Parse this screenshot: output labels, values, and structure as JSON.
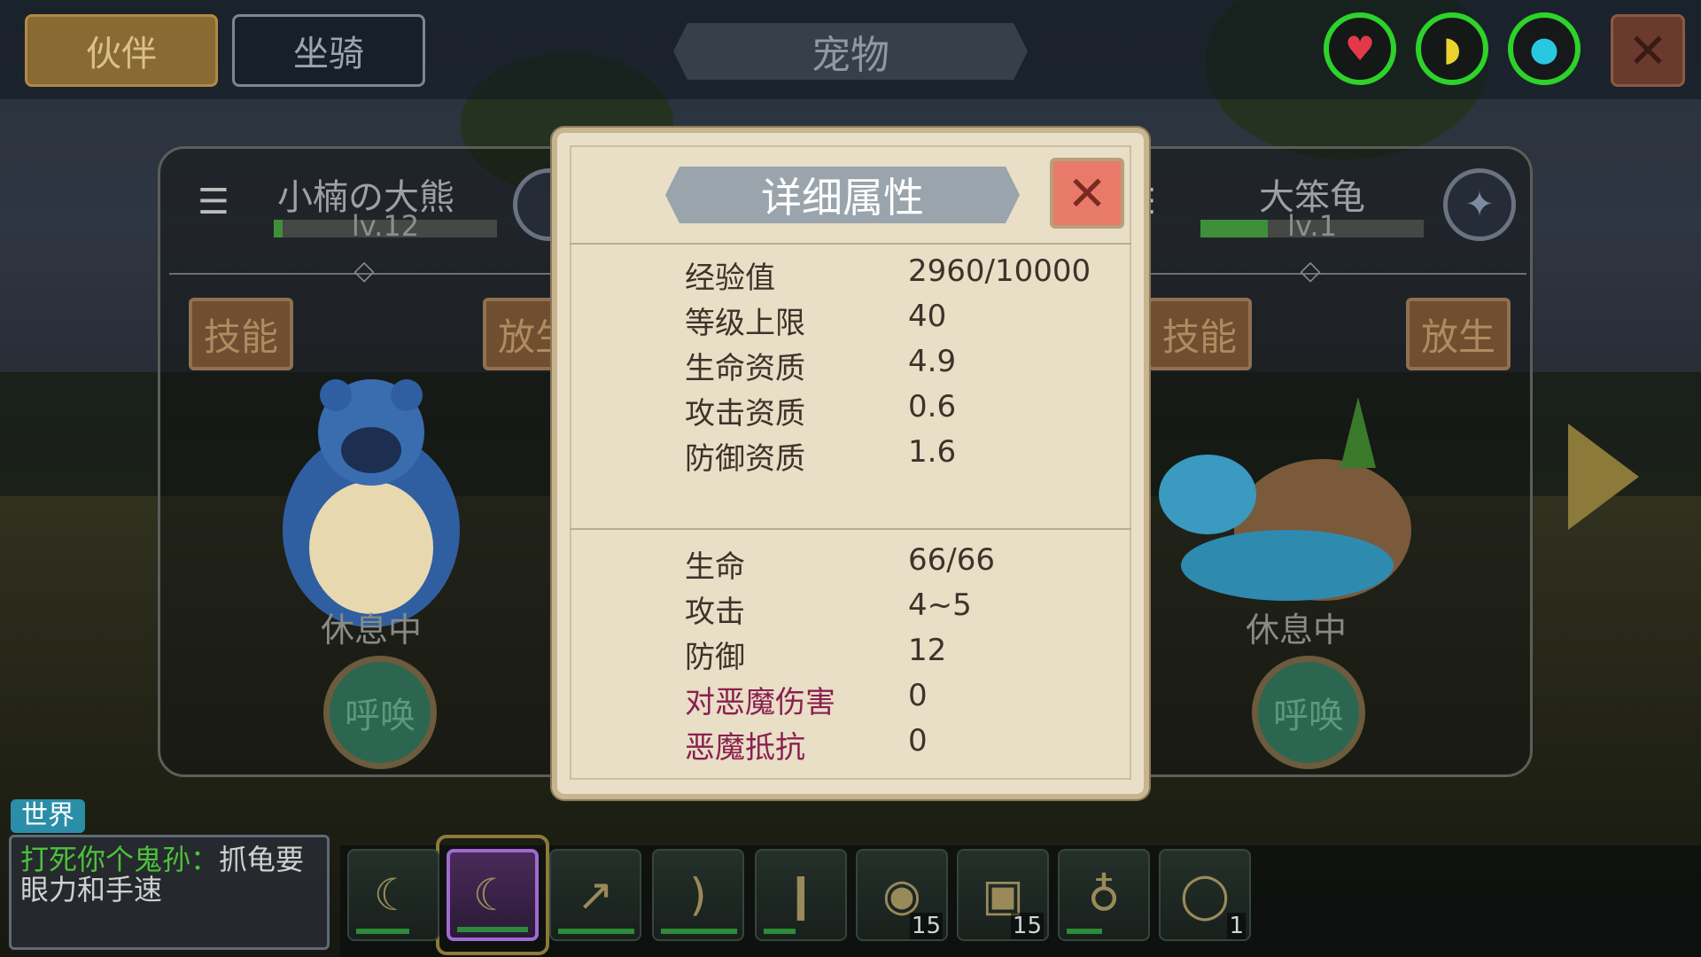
{
  "tabs": {
    "partner": "伙伴",
    "mount": "坐骑"
  },
  "page_title": "宠物",
  "top_stats": [
    "heart-icon",
    "banana-icon",
    "water-drop-icon"
  ],
  "left_pet": {
    "name": "小楠の大熊",
    "level": "lv.12",
    "level_progress": 0.04,
    "skill_label": "技能",
    "release_label": "放生",
    "status": "休息中",
    "summon_label": "呼唤"
  },
  "right_pet": {
    "name": "大笨龟",
    "level": "lv.1",
    "level_progress": 0.3,
    "skill_label": "技能",
    "release_label": "放生",
    "status": "休息中",
    "summon_label": "呼唤"
  },
  "modal": {
    "title": "详细属性",
    "section1": [
      {
        "label": "经验值",
        "value": "2960/10000"
      },
      {
        "label": "等级上限",
        "value": "40"
      },
      {
        "label": "生命资质",
        "value": "4.9"
      },
      {
        "label": "攻击资质",
        "value": "0.6"
      },
      {
        "label": "防御资质",
        "value": "1.6"
      }
    ],
    "section2": [
      {
        "label": "生命",
        "value": "66/66"
      },
      {
        "label": "攻击",
        "value": "4~5"
      },
      {
        "label": "防御",
        "value": "12"
      },
      {
        "label": "对恶魔伤害",
        "value": "0"
      },
      {
        "label": "恶魔抵抗",
        "value": "0"
      }
    ]
  },
  "chat": {
    "channel": "世界",
    "sender": "打死你个鬼孙",
    "message": "抓龟要眼力和手速"
  },
  "items": [
    {
      "icon": "claw-icon",
      "count": ""
    },
    {
      "icon": "purple-claw-icon",
      "count": ""
    },
    {
      "icon": "spear-icon",
      "count": ""
    },
    {
      "icon": "bow-icon",
      "count": ""
    },
    {
      "icon": "club-icon",
      "count": ""
    },
    {
      "icon": "burger-icon",
      "count": "15"
    },
    {
      "icon": "feed-bag-icon",
      "count": "15"
    },
    {
      "icon": "gourd-icon",
      "count": ""
    },
    {
      "icon": "rope-icon",
      "count": "1"
    }
  ]
}
